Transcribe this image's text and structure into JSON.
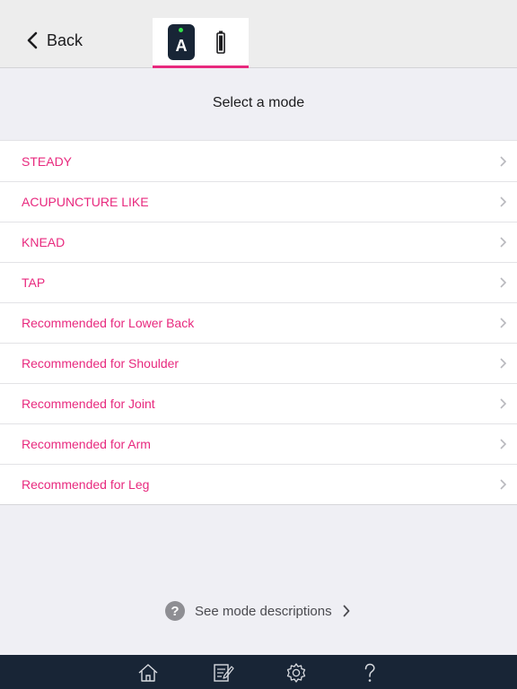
{
  "header": {
    "back_label": "Back",
    "device_label": "A"
  },
  "title": "Select a mode",
  "modes": [
    {
      "label": "STEADY"
    },
    {
      "label": "ACUPUNCTURE LIKE"
    },
    {
      "label": "KNEAD"
    },
    {
      "label": "TAP"
    },
    {
      "label": "Recommended for Lower Back"
    },
    {
      "label": "Recommended for Shoulder"
    },
    {
      "label": "Recommended for Joint"
    },
    {
      "label": "Recommended for Arm"
    },
    {
      "label": "Recommended for Leg"
    }
  ],
  "descriptions_link": {
    "label": "See mode descriptions",
    "icon_glyph": "?"
  },
  "tabbar": {
    "tabs": [
      {
        "icon": "home-icon"
      },
      {
        "icon": "journal-icon"
      },
      {
        "icon": "gear-icon"
      },
      {
        "icon": "help-icon"
      }
    ]
  },
  "colors": {
    "accent": "#e8297e",
    "nav_bar": "#182536",
    "background": "#efeff4",
    "led_on": "#33e04a"
  }
}
